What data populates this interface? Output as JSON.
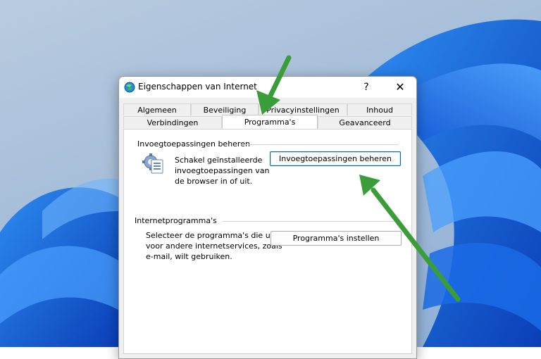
{
  "window": {
    "title": "Eigenschappen van Internet",
    "help_label": "?",
    "close_label": "✕"
  },
  "tabs": {
    "row1": [
      "Algemeen",
      "Beveiliging",
      "Privacyinstellingen",
      "Inhoud"
    ],
    "row2": [
      "Verbindingen",
      "Programma's",
      "Geavanceerd"
    ],
    "active": "Programma's"
  },
  "addons": {
    "group_title": "Invoegtoepassingen beheren",
    "description_lines": [
      "Schakel geïnstalleerde",
      "invoegtoepassingen van",
      "de browser in of uit."
    ],
    "button_label": "Invoegtoepassingen beheren"
  },
  "programs": {
    "group_title": "Internetprogramma's",
    "description_lines": [
      "Selecteer de programma's die u",
      "voor andere internetservices, zoals",
      "e-mail, wilt gebruiken."
    ],
    "button_label": "Programma's instellen"
  },
  "colors": {
    "annotation_arrow": "#3a9d3a",
    "focus_border": "#0067c0",
    "wallpaper_blue": "#1f6fe0"
  }
}
